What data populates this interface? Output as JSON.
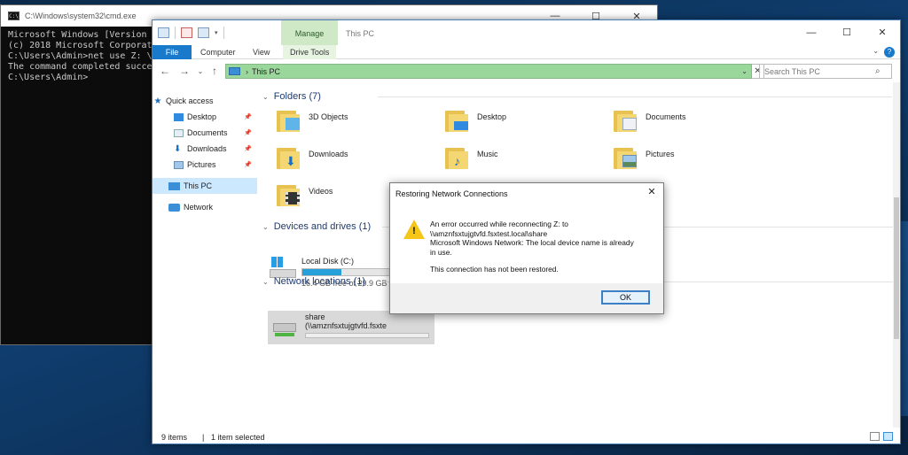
{
  "cmd": {
    "title": "C:\\Windows\\system32\\cmd.exe",
    "lines": [
      "Microsoft Windows [Version",
      "(c) 2018 Microsoft Corporat",
      "",
      "C:\\Users\\Admin>net use Z: \\",
      "The command completed succe",
      "",
      "",
      "C:\\Users\\Admin>"
    ]
  },
  "explorer": {
    "manage_tab": "Manage",
    "window_title": "This PC",
    "ribbon": {
      "file": "File",
      "computer": "Computer",
      "view": "View",
      "drive_tools": "Drive Tools"
    },
    "address": {
      "path": "This PC"
    },
    "search": {
      "placeholder": "Search This PC"
    },
    "nav": {
      "quick_access": "Quick access",
      "items": [
        "Desktop",
        "Documents",
        "Downloads",
        "Pictures"
      ],
      "this_pc": "This PC",
      "network": "Network"
    },
    "groups": {
      "folders": "Folders (7)",
      "devices": "Devices and drives (1)",
      "network": "Network locations (1)"
    },
    "folders": [
      "3D Objects",
      "Desktop",
      "Documents",
      "Downloads",
      "Music",
      "Pictures",
      "Videos"
    ],
    "drive": {
      "name": "Local Disk (C:)",
      "free": "16.4 GB free of 29.9 GB",
      "used_fraction": 0.45
    },
    "network_location": {
      "name": "share",
      "path": "(\\\\amznfsxtujgtvfd.fsxte"
    },
    "status": {
      "items": "9 items",
      "selected": "1 item selected"
    }
  },
  "dialog": {
    "title": "Restoring Network Connections",
    "line1": "An error occurred while reconnecting Z: to",
    "line2": "\\\\amznfsxtujgtvfd.fsxtest.local\\share",
    "line3": "Microsoft Windows Network: The local device name is already",
    "line4": "in use.",
    "line5": "This connection has not been restored.",
    "ok": "OK"
  },
  "colors": {
    "accent": "#1979ca",
    "manage_green": "#cfe9c6",
    "address_green": "#9ad79a",
    "selection": "#cce8ff",
    "warning": "#f5c518"
  }
}
